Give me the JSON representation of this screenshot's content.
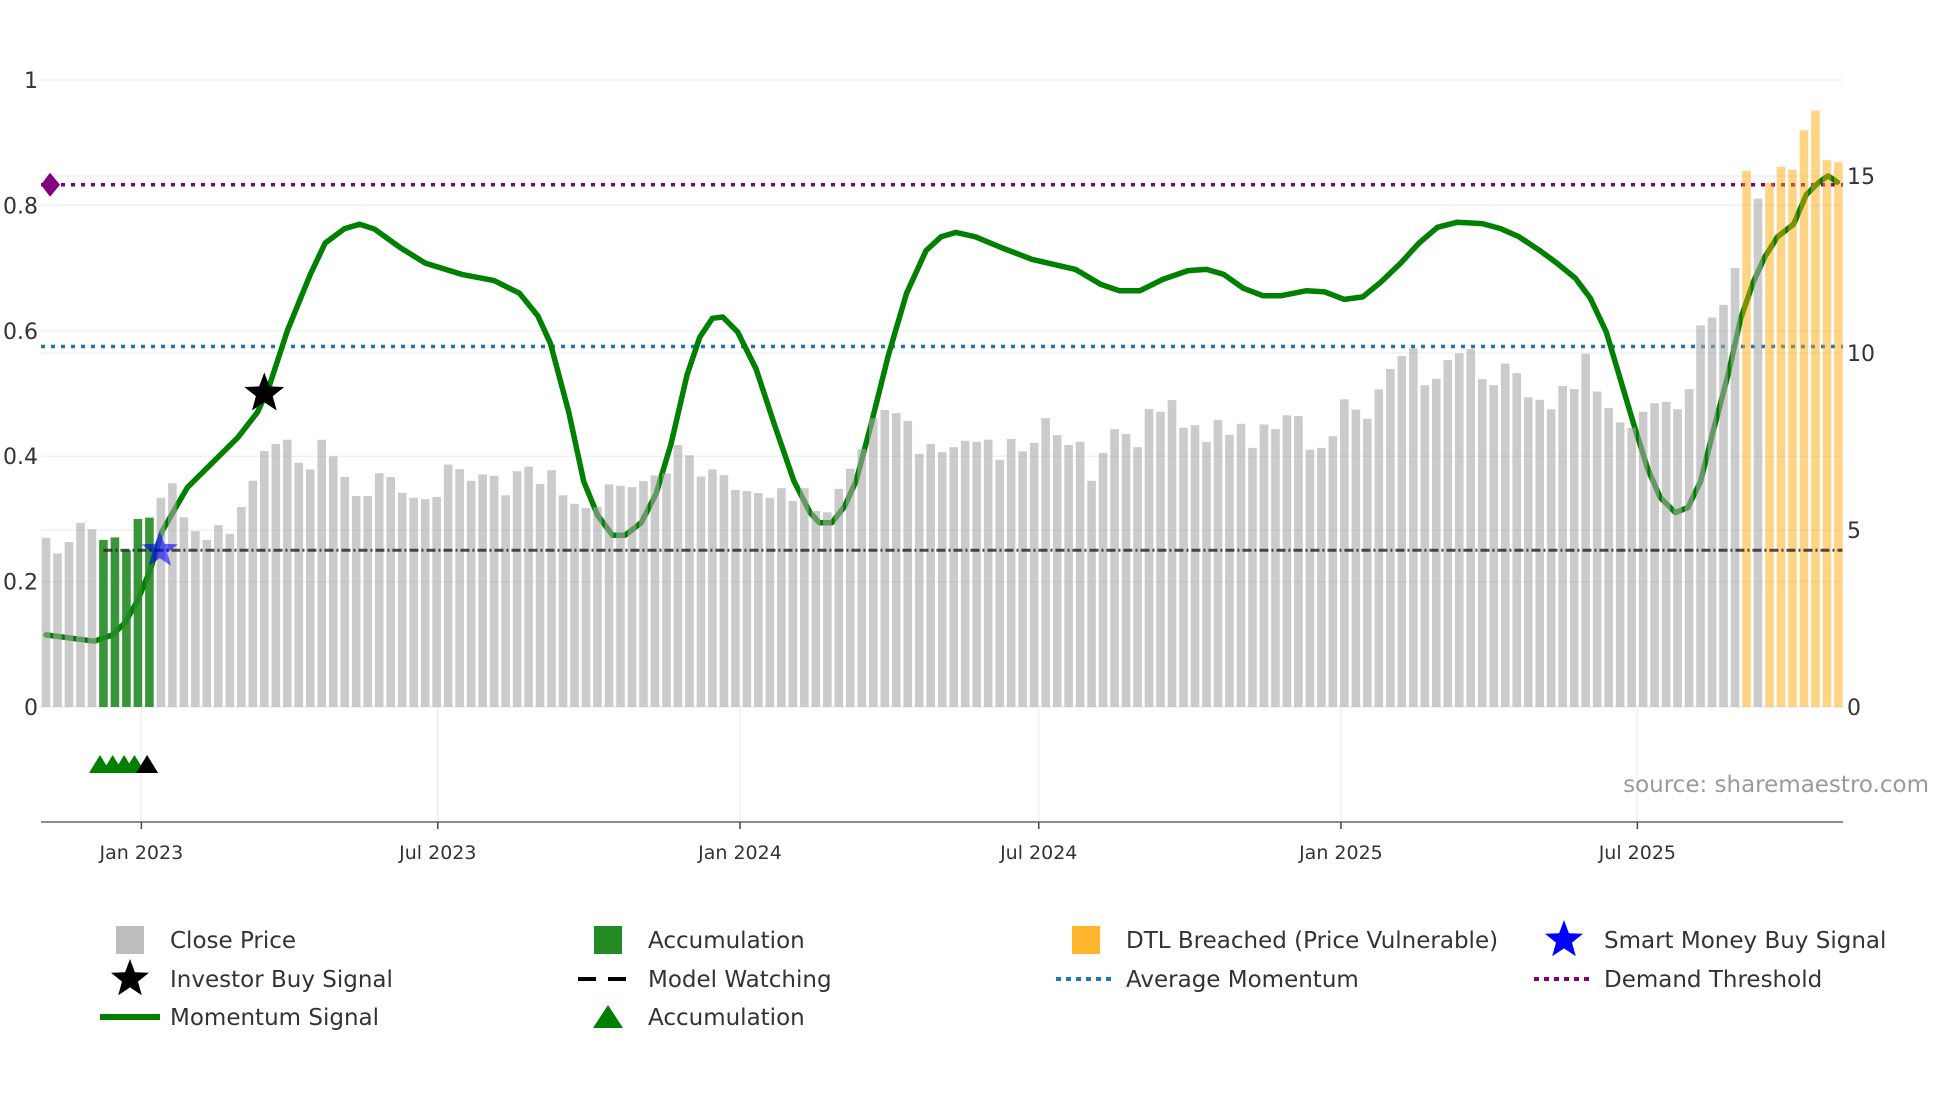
{
  "chart_data": {
    "type": "bar",
    "title": "",
    "source": "source: sharemaestro.com",
    "left_axis": {
      "ticks": [
        0,
        0.2,
        0.4,
        0.6,
        0.8,
        1
      ],
      "tick_labels": [
        "0",
        "0.2",
        "0.4",
        "0.6",
        "0.8",
        "1"
      ],
      "range": [
        0,
        1
      ]
    },
    "right_axis": {
      "ticks": [
        0,
        5,
        10,
        15
      ],
      "tick_labels": [
        "0",
        "5",
        "10",
        "15"
      ],
      "range": [
        0,
        17.7
      ]
    },
    "x_axis": {
      "unit": "week index",
      "ticks": [
        8.3,
        34.1,
        60.4,
        86.4,
        112.7,
        138.5
      ],
      "tick_labels": [
        "Jan 2023",
        "Jul 2023",
        "Jan 2024",
        "Jul 2024",
        "Jan 2025",
        "Jul 2025"
      ]
    },
    "grid": true,
    "close_price": [
      4.78,
      4.34,
      4.66,
      5.2,
      5.02,
      4.72,
      4.79,
      4.43,
      5.31,
      5.35,
      5.91,
      6.32,
      5.36,
      4.97,
      4.72,
      5.14,
      4.89,
      5.65,
      6.39,
      7.23,
      7.43,
      7.55,
      6.9,
      6.71,
      7.55,
      7.08,
      6.5,
      5.96,
      5.96,
      6.6,
      6.5,
      6.05,
      5.91,
      5.87,
      5.93,
      6.85,
      6.72,
      6.39,
      6.57,
      6.53,
      5.98,
      6.66,
      6.79,
      6.3,
      6.69,
      5.98,
      5.74,
      5.62,
      5.65,
      6.29,
      6.25,
      6.21,
      6.38,
      6.54,
      6.6,
      7.4,
      7.11,
      6.51,
      6.71,
      6.55,
      6.13,
      6.1,
      6.04,
      5.91,
      6.18,
      5.82,
      6.18,
      5.54,
      5.5,
      6.16,
      6.73,
      7.29,
      8.16,
      8.39,
      8.3,
      8.08,
      7.15,
      7.43,
      7.2,
      7.34,
      7.52,
      7.49,
      7.55,
      6.98,
      7.57,
      7.22,
      7.46,
      8.16,
      7.68,
      7.4,
      7.49,
      6.39,
      7.18,
      7.85,
      7.71,
      7.34,
      8.42,
      8.34,
      8.67,
      7.89,
      7.96,
      7.49,
      8.11,
      7.69,
      8.0,
      7.32,
      7.98,
      7.85,
      8.24,
      8.22,
      7.27,
      7.32,
      7.65,
      8.69,
      8.4,
      8.14,
      8.97,
      9.55,
      9.91,
      10.13,
      9.09,
      9.27,
      9.8,
      9.99,
      10.11,
      9.26,
      9.09,
      9.7,
      9.43,
      8.75,
      8.68,
      8.41,
      9.07,
      8.98,
      9.98,
      8.91,
      8.45,
      8.04,
      7.89,
      8.34,
      8.58,
      8.62,
      8.41,
      8.98,
      10.78,
      11.0,
      11.36,
      12.4,
      15.15,
      14.36,
      14.81,
      15.26,
      15.18,
      16.29,
      16.85,
      15.45,
      15.39
    ],
    "accumulation_bar_indices": [
      5,
      6,
      7,
      8,
      9
    ],
    "dtl_breached_bar_indices": [
      148,
      150,
      151,
      152,
      153,
      154,
      155,
      156
    ],
    "momentum": [
      [
        0,
        0.115
      ],
      [
        4.2,
        0.105
      ],
      [
        5.8,
        0.115
      ],
      [
        6.9,
        0.135
      ],
      [
        8.0,
        0.171
      ],
      [
        9.1,
        0.22
      ],
      [
        10.1,
        0.28
      ],
      [
        12.3,
        0.35
      ],
      [
        14.5,
        0.39
      ],
      [
        16.7,
        0.43
      ],
      [
        18.4,
        0.47
      ],
      [
        19.4,
        0.51
      ],
      [
        21.0,
        0.6
      ],
      [
        23.0,
        0.69
      ],
      [
        24.3,
        0.74
      ],
      [
        26.0,
        0.763
      ],
      [
        27.3,
        0.77
      ],
      [
        28.6,
        0.762
      ],
      [
        30.8,
        0.733
      ],
      [
        33.0,
        0.708
      ],
      [
        36.2,
        0.69
      ],
      [
        39.0,
        0.68
      ],
      [
        41.2,
        0.66
      ],
      [
        42.8,
        0.624
      ],
      [
        43.9,
        0.58
      ],
      [
        45.5,
        0.47
      ],
      [
        46.8,
        0.36
      ],
      [
        48.0,
        0.306
      ],
      [
        49.3,
        0.274
      ],
      [
        50.4,
        0.274
      ],
      [
        51.8,
        0.294
      ],
      [
        53.1,
        0.34
      ],
      [
        54.4,
        0.42
      ],
      [
        55.8,
        0.53
      ],
      [
        56.9,
        0.59
      ],
      [
        58.0,
        0.62
      ],
      [
        58.9,
        0.622
      ],
      [
        60.2,
        0.598
      ],
      [
        61.8,
        0.539
      ],
      [
        63.4,
        0.45
      ],
      [
        65.1,
        0.36
      ],
      [
        66.5,
        0.31
      ],
      [
        67.3,
        0.294
      ],
      [
        68.4,
        0.294
      ],
      [
        69.5,
        0.32
      ],
      [
        70.5,
        0.36
      ],
      [
        71.8,
        0.45
      ],
      [
        73.3,
        0.56
      ],
      [
        74.9,
        0.66
      ],
      [
        76.6,
        0.728
      ],
      [
        77.9,
        0.75
      ],
      [
        79.2,
        0.757
      ],
      [
        80.9,
        0.75
      ],
      [
        83.1,
        0.733
      ],
      [
        85.8,
        0.714
      ],
      [
        89.6,
        0.698
      ],
      [
        91.8,
        0.674
      ],
      [
        93.4,
        0.664
      ],
      [
        95.2,
        0.664
      ],
      [
        97.2,
        0.682
      ],
      [
        99.4,
        0.696
      ],
      [
        101.0,
        0.698
      ],
      [
        102.5,
        0.69
      ],
      [
        104.2,
        0.668
      ],
      [
        105.9,
        0.656
      ],
      [
        107.5,
        0.656
      ],
      [
        109.7,
        0.664
      ],
      [
        111.3,
        0.662
      ],
      [
        113.0,
        0.65
      ],
      [
        114.6,
        0.654
      ],
      [
        116.2,
        0.678
      ],
      [
        117.9,
        0.708
      ],
      [
        119.5,
        0.74
      ],
      [
        121.1,
        0.765
      ],
      [
        122.8,
        0.773
      ],
      [
        125.0,
        0.771
      ],
      [
        126.6,
        0.763
      ],
      [
        128.2,
        0.75
      ],
      [
        130.0,
        0.728
      ],
      [
        131.5,
        0.708
      ],
      [
        133.1,
        0.684
      ],
      [
        134.4,
        0.652
      ],
      [
        135.8,
        0.598
      ],
      [
        136.9,
        0.53
      ],
      [
        138.2,
        0.45
      ],
      [
        139.4,
        0.38
      ],
      [
        140.5,
        0.334
      ],
      [
        141.8,
        0.31
      ],
      [
        142.9,
        0.318
      ],
      [
        144.0,
        0.36
      ],
      [
        145.1,
        0.44
      ],
      [
        146.4,
        0.53
      ],
      [
        147.5,
        0.62
      ],
      [
        148.6,
        0.678
      ],
      [
        149.6,
        0.718
      ],
      [
        150.7,
        0.75
      ],
      [
        152.1,
        0.77
      ],
      [
        153.2,
        0.817
      ],
      [
        154.3,
        0.837
      ],
      [
        155.1,
        0.847
      ],
      [
        155.9,
        0.837
      ]
    ],
    "average_momentum": 0.575,
    "demand_threshold": 0.833,
    "model_watching": {
      "value": 0.25,
      "from": 5,
      "to": 156
    },
    "investor_buy_signal": [
      [
        19.0,
        0.5
      ]
    ],
    "smart_money_buy_signal": [
      [
        9.9,
        0.25
      ]
    ],
    "accumulation_markers": [
      4.7,
      5.8,
      6.8,
      7.7
    ],
    "watch_markers": [
      8.8
    ],
    "legend_position": "bottom",
    "legend": [
      {
        "label": "Close Price",
        "icon": "grey-square"
      },
      {
        "label": "Accumulation",
        "icon": "green-square"
      },
      {
        "label": "DTL Breached (Price Vulnerable)",
        "icon": "orange-square"
      },
      {
        "label": "Smart Money Buy Signal",
        "icon": "blue-star"
      },
      {
        "label": "Investor Buy Signal",
        "icon": "black-star"
      },
      {
        "label": "Model Watching",
        "icon": "black-dash"
      },
      {
        "label": "Average Momentum",
        "icon": "blue-dotted-line"
      },
      {
        "label": "Demand Threshold",
        "icon": "purple-dotted-line"
      },
      {
        "label": "Momentum Signal",
        "icon": "green-line"
      },
      {
        "label": "Accumulation",
        "icon": "green-triangle"
      }
    ],
    "colors": {
      "close": "#a9a9a9",
      "accum": "#228b22",
      "dtl": "#ffa500",
      "momentum": "#008000",
      "avg": "#1f77b4",
      "demand": "#800080",
      "watch": "#222222",
      "smart": "#0000ff",
      "investor": "#000000"
    }
  }
}
